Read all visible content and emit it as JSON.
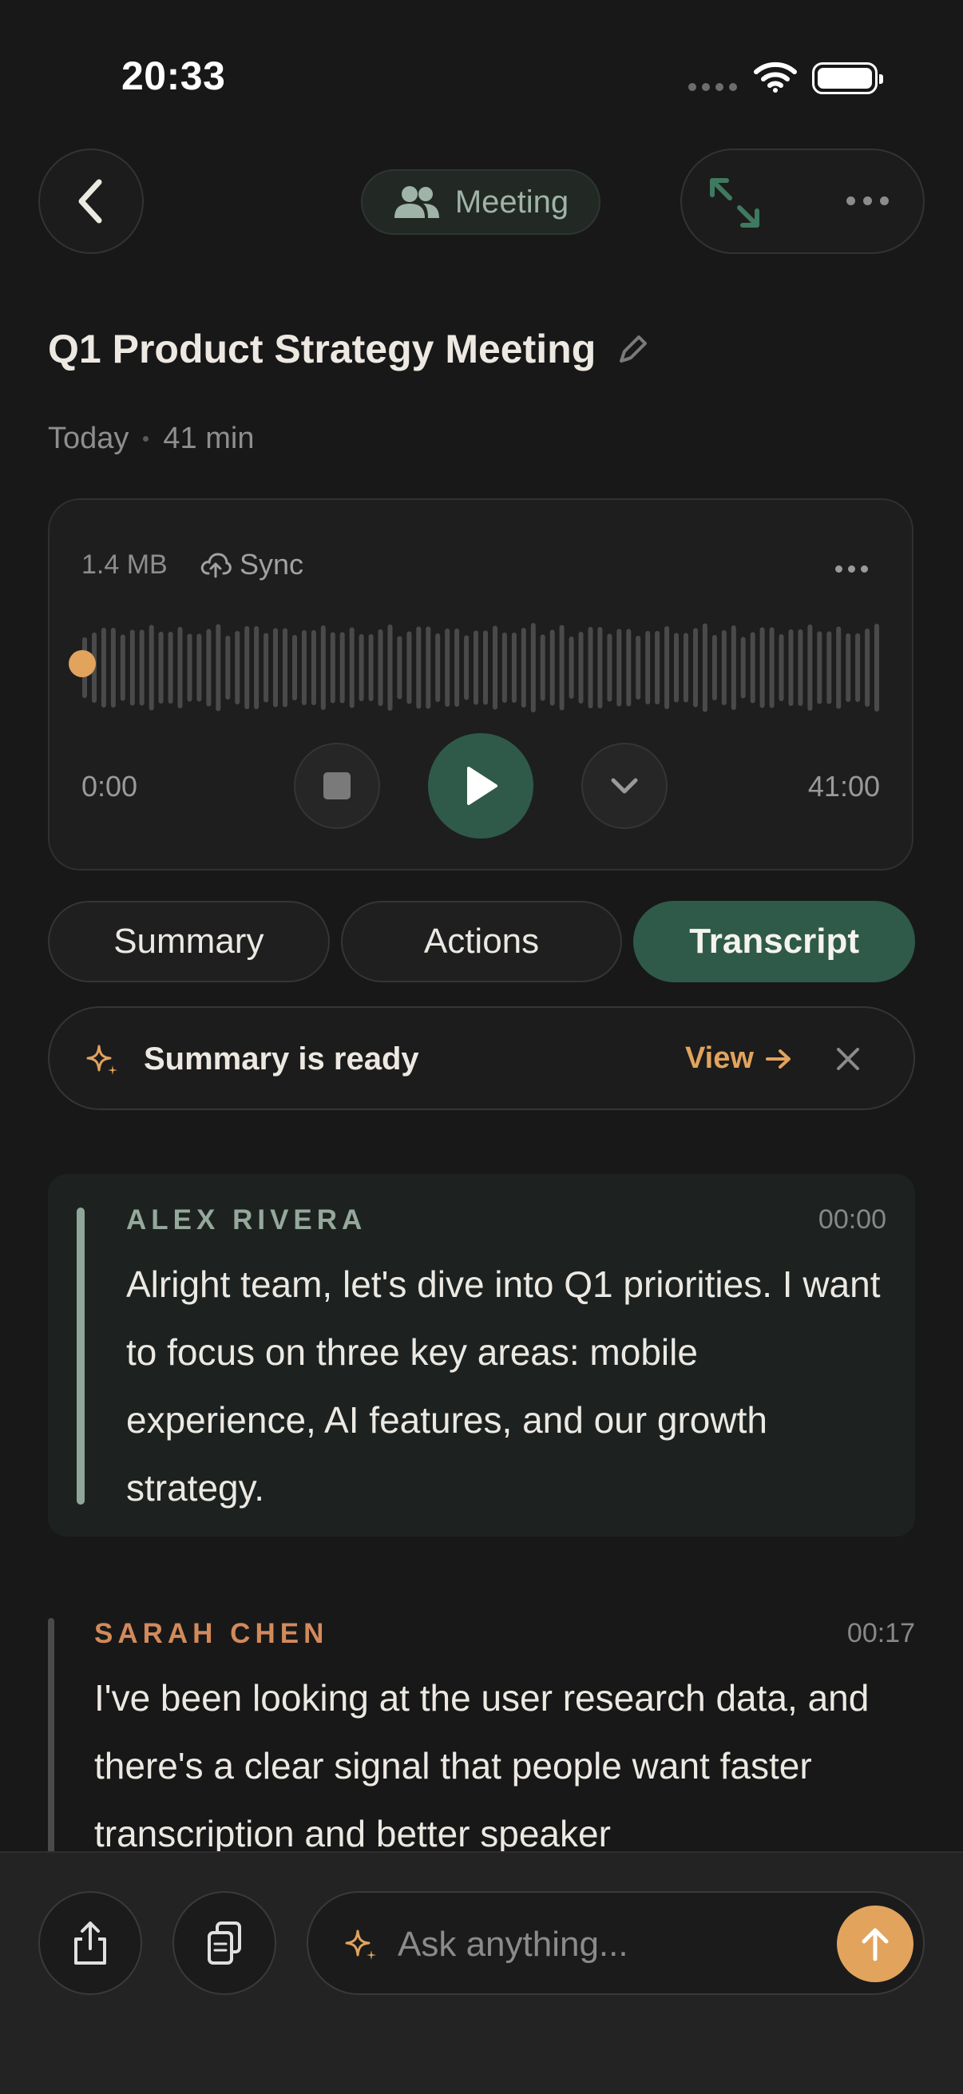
{
  "status_bar": {
    "time": "20:33"
  },
  "header": {
    "meeting_label": "Meeting",
    "title": "Q1 Product Strategy Meeting",
    "date": "Today",
    "duration": "41 min"
  },
  "player": {
    "file_size": "1.4 MB",
    "sync_label": "Sync",
    "current_time": "0:00",
    "total_time": "41:00",
    "progress": 0
  },
  "tabs": [
    {
      "label": "Summary",
      "active": false
    },
    {
      "label": "Actions",
      "active": false
    },
    {
      "label": "Transcript",
      "active": true
    }
  ],
  "banner": {
    "text": "Summary is ready",
    "action": "View"
  },
  "transcript": [
    {
      "speaker": "ALEX RIVERA",
      "time": "00:00",
      "text": "Alright team, let's dive into Q1 priorities. I want to focus on three key areas: mobile experience, AI features, and our growth strategy."
    },
    {
      "speaker": "SARAH CHEN",
      "time": "00:17",
      "text": "I've been looking at the user research data, and there's a clear signal that people want faster transcription and better speaker"
    }
  ],
  "composer": {
    "placeholder": "Ask anything..."
  },
  "colors": {
    "accent_green": "#2f5a49",
    "accent_orange": "#e2a35d",
    "speaker_1": "#95a89c",
    "speaker_2": "#d28a5b",
    "background": "#181818"
  },
  "icons": {
    "back": "chevron-left-icon",
    "meeting": "people-icon",
    "expand": "expand-icon",
    "more": "more-horizontal-icon",
    "edit": "pencil-icon",
    "sync": "cloud-upload-icon",
    "stop": "stop-icon",
    "play": "play-icon",
    "collapse": "chevron-down-icon",
    "sparkle": "sparkle-icon",
    "close": "close-icon",
    "share": "share-icon",
    "copy": "copy-icon",
    "send": "arrow-up-icon"
  }
}
